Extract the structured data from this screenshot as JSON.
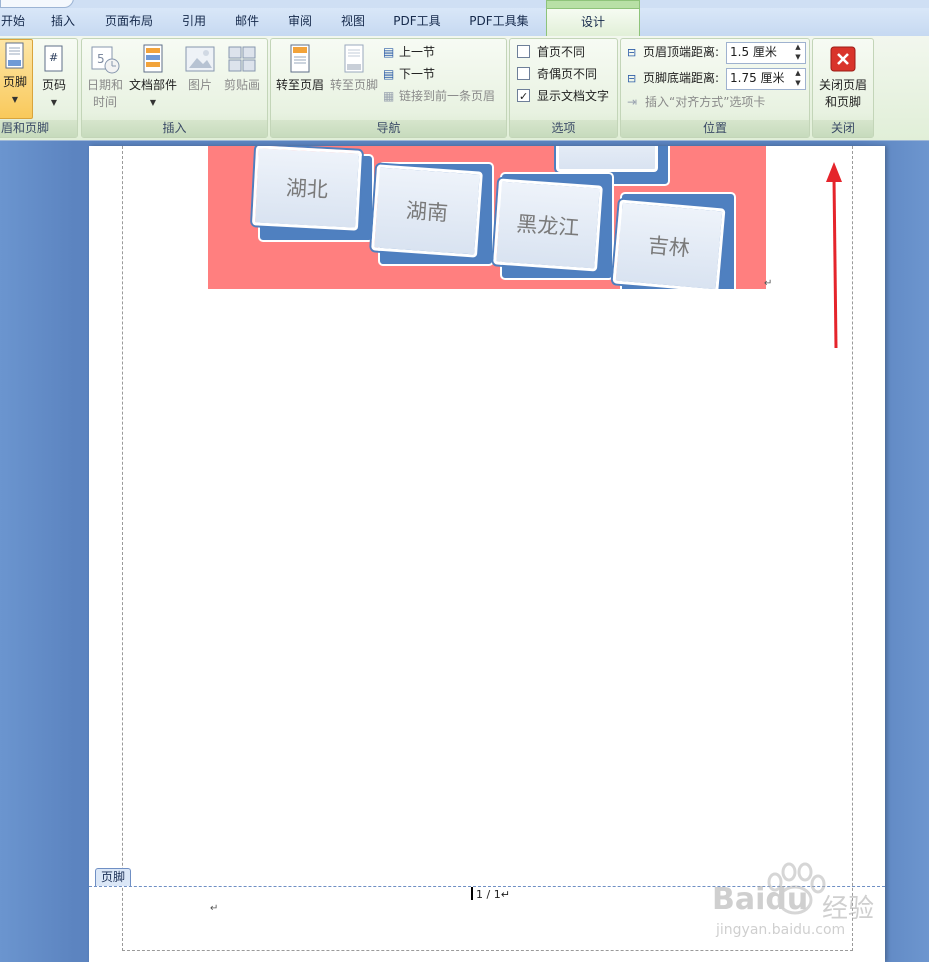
{
  "tabs": [
    {
      "label": "开始"
    },
    {
      "label": "插入"
    },
    {
      "label": "页面布局"
    },
    {
      "label": "引用"
    },
    {
      "label": "邮件"
    },
    {
      "label": "审阅"
    },
    {
      "label": "视图"
    },
    {
      "label": "PDF工具"
    },
    {
      "label": "PDF工具集"
    },
    {
      "label": "设计"
    }
  ],
  "active_tab": "设计",
  "ribbon": {
    "groups": {
      "header_footer": "眉和页脚",
      "insert": "插入",
      "navigation": "导航",
      "options": "选项",
      "position": "位置",
      "close": "关闭"
    },
    "footer_btn": "页脚",
    "page_number_btn": "页码",
    "datetime_line1": "日期和",
    "datetime_line2": "时间",
    "quick_parts": "文档部件",
    "picture": "图片",
    "clip_art": "剪贴画",
    "goto_header": "转至页眉",
    "goto_footer": "转至页脚",
    "prev_section": "上一节",
    "next_section": "下一节",
    "link_previous": "链接到前一条页眉",
    "opt_first_page": "首页不同",
    "opt_odd_even": "奇偶页不同",
    "opt_show_text": "显示文档文字",
    "opt_first_page_checked": false,
    "opt_odd_even_checked": false,
    "opt_show_text_checked": true,
    "header_distance_label": "页眉顶端距离:",
    "header_distance_value": "1.5 厘米",
    "footer_distance_label": "页脚底端距离:",
    "footer_distance_value": "1.75 厘米",
    "insert_align_tab": "插入“对齐方式”选项卡",
    "close_line1": "关闭页眉",
    "close_line2": "和页脚"
  },
  "document": {
    "blocks": [
      {
        "label": "湖北"
      },
      {
        "label": "湖南"
      },
      {
        "label": "黑龙江"
      },
      {
        "label": "吉林"
      }
    ],
    "footer_tag": "页脚",
    "page_number": "1 / 1",
    "return_mark": "↵"
  },
  "watermark": {
    "brand": "Baidu",
    "brand_cn": "经验",
    "url": "jingyan.baidu.com"
  },
  "colors": {
    "accent_arrow": "#e5242b",
    "diagram_bg": "#ff7f7f",
    "block_blue": "#4f80c0"
  }
}
